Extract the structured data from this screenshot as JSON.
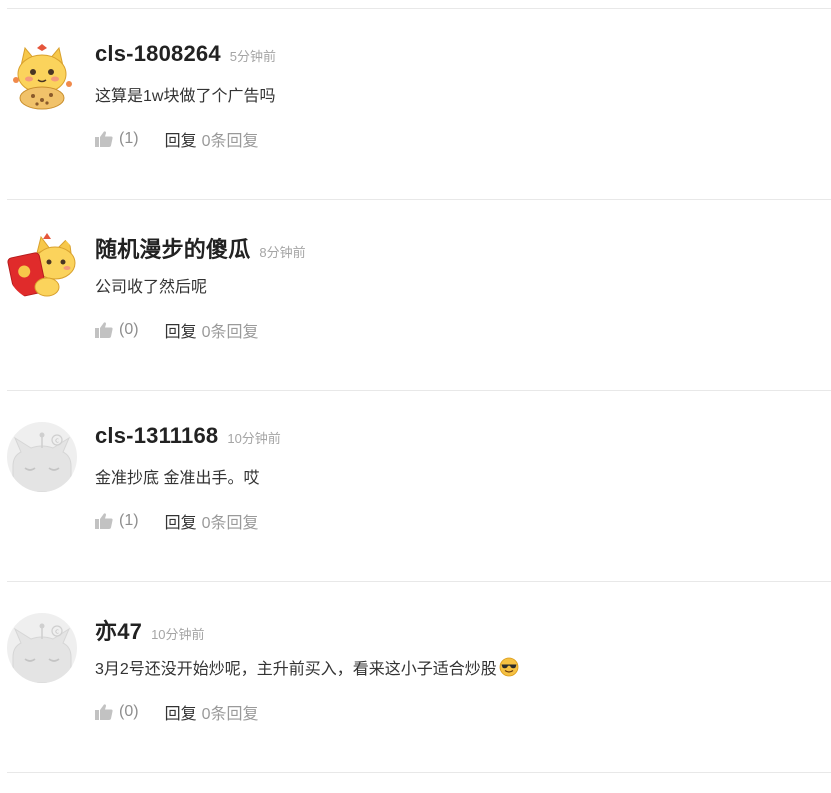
{
  "comments": [
    {
      "username": "cls-1808264",
      "time": "5分钟前",
      "text": "这算是1w块做了个广告吗",
      "avatar": "yellow-cat-cookie-avatar",
      "likes": "(1)",
      "reply_label": "回复",
      "reply_count": "0条回复"
    },
    {
      "username": "随机漫步的傻瓜",
      "time": "8分钟前",
      "text": "公司收了然后呢",
      "avatar": "yellow-cat-red-envelope-avatar",
      "likes": "(0)",
      "reply_label": "回复",
      "reply_count": "0条回复"
    },
    {
      "username": "cls-1311168",
      "time": "10分钟前",
      "text": "金准抄底 金准出手。哎",
      "avatar": "gray-default-cat-avatar",
      "likes": "(1)",
      "reply_label": "回复",
      "reply_count": "0条回复"
    },
    {
      "username": "亦47",
      "time": "10分钟前",
      "text": "3月2号还没开始炒呢，主升前买入，看来这小子适合炒股",
      "emoji": "sunglasses-emoji",
      "avatar": "gray-default-cat-avatar",
      "likes": "(0)",
      "reply_label": "回复",
      "reply_count": "0条回复"
    }
  ],
  "colors": {
    "username": "#222222",
    "time": "#a5a5a5",
    "like": "#8e8e8e",
    "reply_count": "#9a9a9a",
    "divider": "#e8e8e8"
  }
}
